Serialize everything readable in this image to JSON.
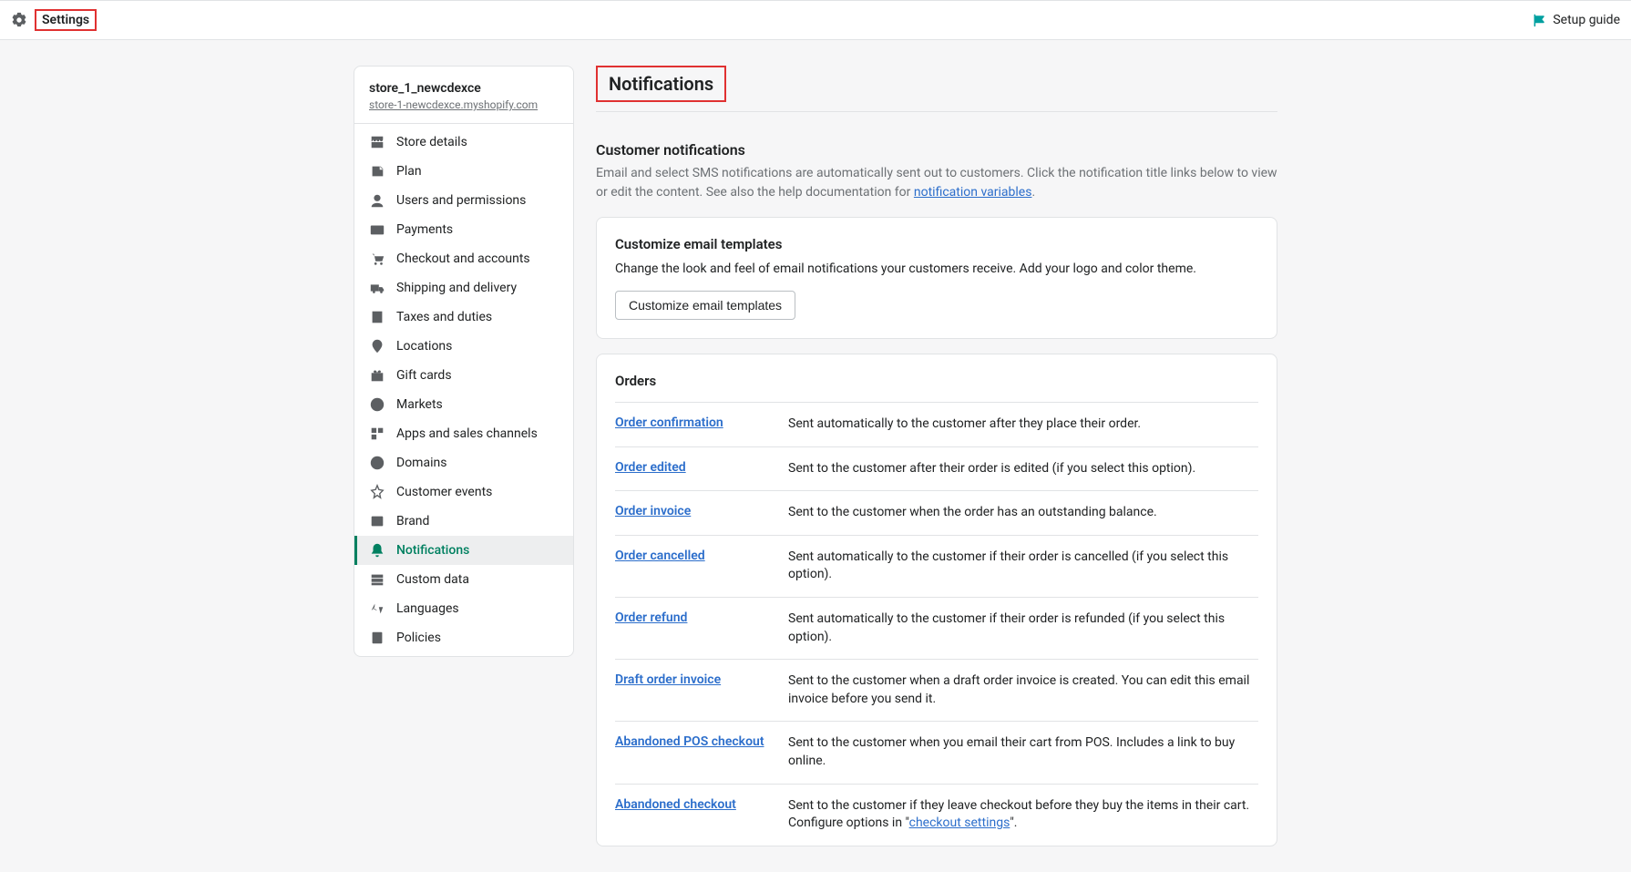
{
  "topbar": {
    "settings_label": "Settings",
    "setup_guide_label": "Setup guide"
  },
  "store": {
    "name": "store_1_newcdexce",
    "url": "store-1-newcdexce.myshopify.com"
  },
  "nav": [
    {
      "key": "store-details",
      "label": "Store details"
    },
    {
      "key": "plan",
      "label": "Plan"
    },
    {
      "key": "users",
      "label": "Users and permissions"
    },
    {
      "key": "payments",
      "label": "Payments"
    },
    {
      "key": "checkout",
      "label": "Checkout and accounts"
    },
    {
      "key": "shipping",
      "label": "Shipping and delivery"
    },
    {
      "key": "taxes",
      "label": "Taxes and duties"
    },
    {
      "key": "locations",
      "label": "Locations"
    },
    {
      "key": "gift-cards",
      "label": "Gift cards"
    },
    {
      "key": "markets",
      "label": "Markets"
    },
    {
      "key": "apps",
      "label": "Apps and sales channels"
    },
    {
      "key": "domains",
      "label": "Domains"
    },
    {
      "key": "customer-events",
      "label": "Customer events"
    },
    {
      "key": "brand",
      "label": "Brand"
    },
    {
      "key": "notifications",
      "label": "Notifications"
    },
    {
      "key": "custom-data",
      "label": "Custom data"
    },
    {
      "key": "languages",
      "label": "Languages"
    },
    {
      "key": "policies",
      "label": "Policies"
    }
  ],
  "page": {
    "title": "Notifications",
    "intro_heading": "Customer notifications",
    "intro_text_1": "Email and select SMS notifications are automatically sent out to customers. Click the notification title links below to view or edit the content. See also the help documentation for ",
    "intro_link": "notification variables",
    "intro_text_2": "."
  },
  "customize_card": {
    "heading": "Customize email templates",
    "text": "Change the look and feel of email notifications your customers receive. Add your logo and color theme.",
    "button": "Customize email templates"
  },
  "orders_card": {
    "heading": "Orders",
    "rows": [
      {
        "title": "Order confirmation",
        "desc": "Sent automatically to the customer after they place their order."
      },
      {
        "title": "Order edited",
        "desc": "Sent to the customer after their order is edited (if you select this option)."
      },
      {
        "title": "Order invoice",
        "desc": "Sent to the customer when the order has an outstanding balance."
      },
      {
        "title": "Order cancelled",
        "desc": "Sent automatically to the customer if their order is cancelled (if you select this option)."
      },
      {
        "title": "Order refund",
        "desc": "Sent automatically to the customer if their order is refunded (if you select this option)."
      },
      {
        "title": "Draft order invoice",
        "desc": "Sent to the customer when a draft order invoice is created. You can edit this email invoice before you send it."
      },
      {
        "title": "Abandoned POS checkout",
        "desc": "Sent to the customer when you email their cart from POS. Includes a link to buy online."
      }
    ],
    "abandoned_checkout": {
      "title": "Abandoned checkout",
      "desc_1": "Sent to the customer if they leave checkout before they buy the items in their cart. Configure options in \"",
      "link": "checkout settings",
      "desc_2": "\"."
    }
  }
}
